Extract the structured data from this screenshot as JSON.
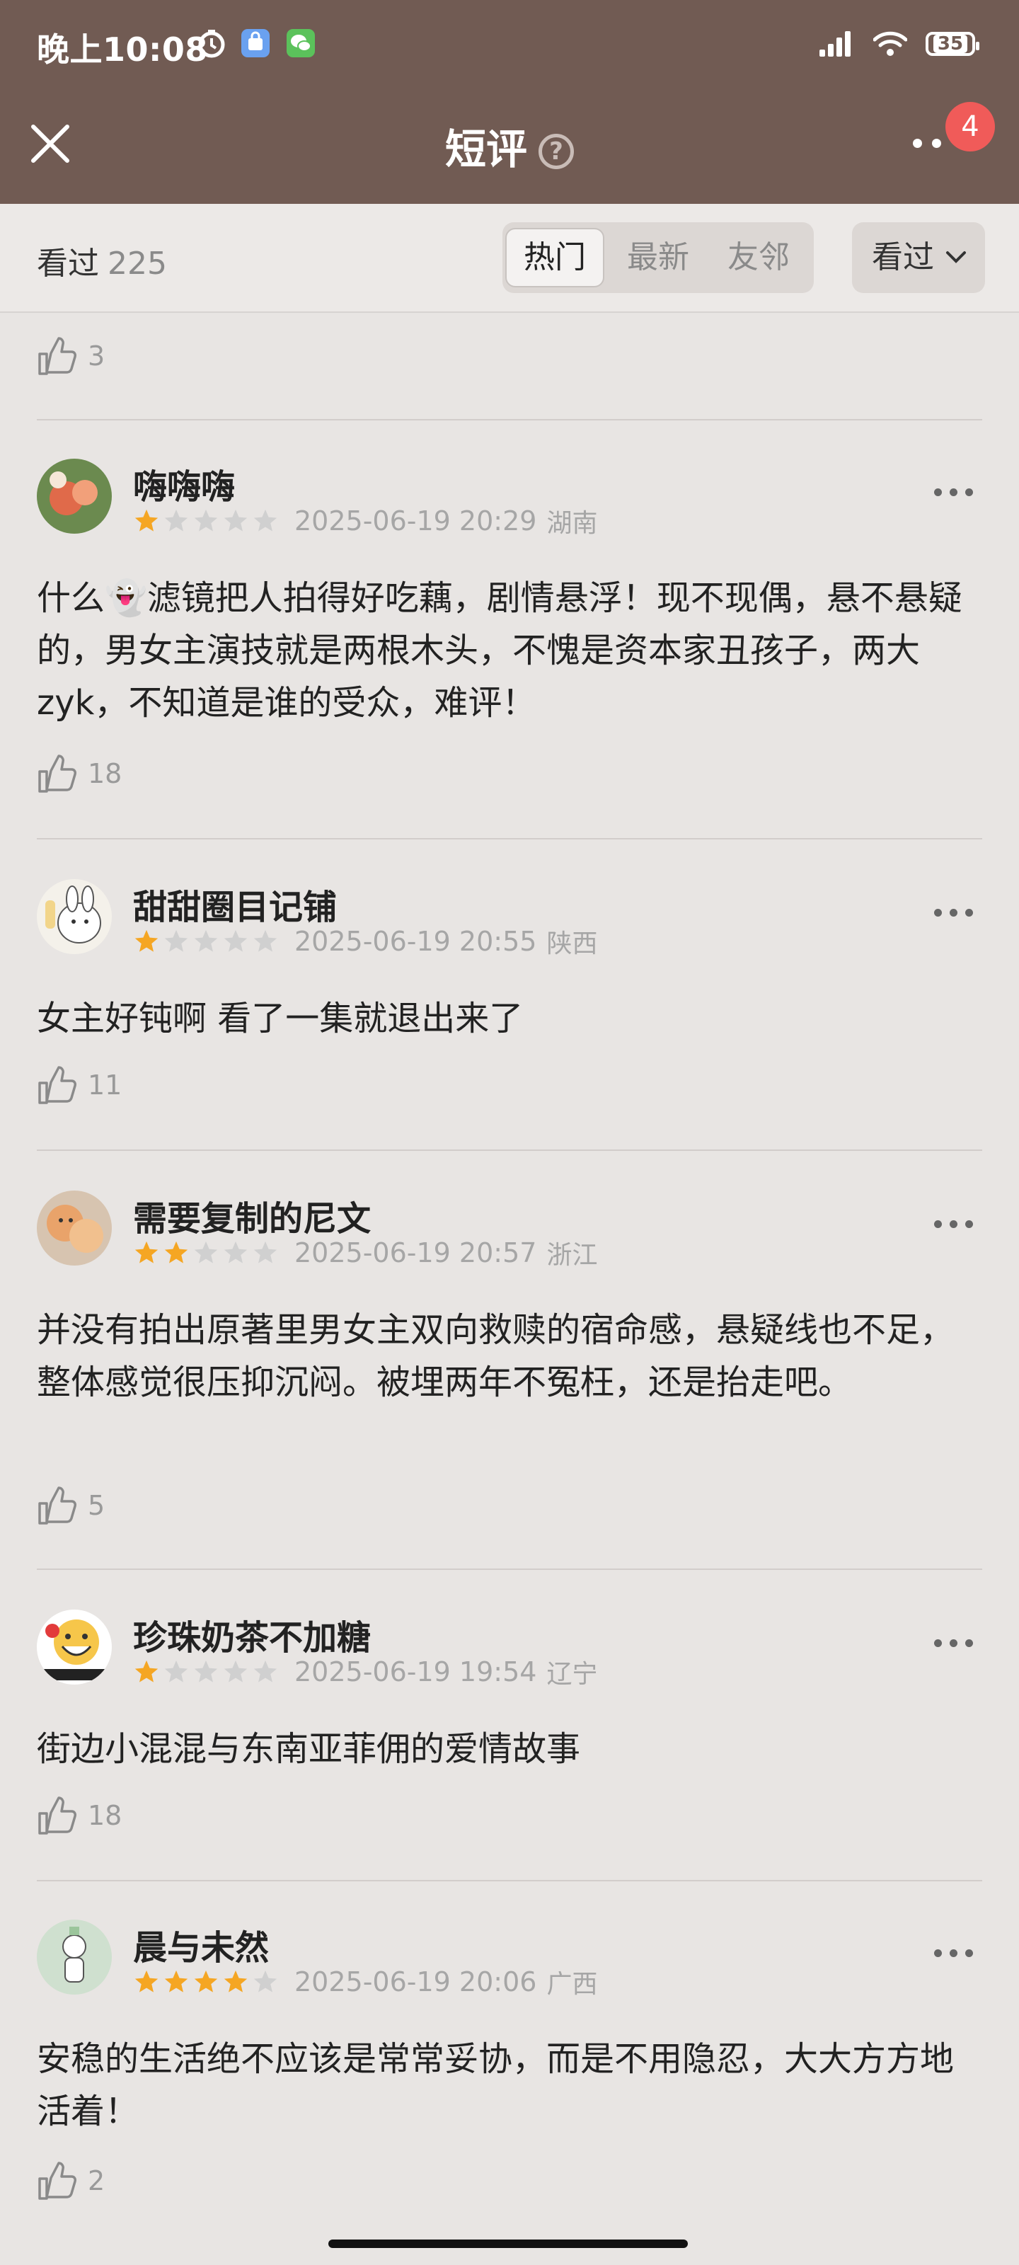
{
  "status_bar": {
    "time": "晚上10:08",
    "battery": "35"
  },
  "header": {
    "title": "短评",
    "help_icon": "?",
    "notification_count": "4"
  },
  "filter": {
    "seen_label": "看过",
    "seen_count": "225",
    "tabs": [
      {
        "label": "热门"
      },
      {
        "label": "最新"
      },
      {
        "label": "友邻"
      }
    ],
    "dropdown_label": "看过"
  },
  "top_like": {
    "count": "3"
  },
  "reviews": [
    {
      "username": "嗨嗨嗨",
      "rating": 1,
      "date": "2025-06-19 20:29",
      "region": "湖南",
      "text": "什么👻滤镜把人拍得好吃藕，剧情悬浮！现不现偶，悬不悬疑的，男女主演技就是两根木头，不愧是资本家丑孩子，两大zyk，不知道是谁的受众，难评！",
      "likes": "18"
    },
    {
      "username": "甜甜圈目记铺",
      "rating": 1,
      "date": "2025-06-19 20:55",
      "region": "陕西",
      "text": "女主好钝啊 看了一集就退出来了",
      "likes": "11"
    },
    {
      "username": "需要复制的尼文",
      "rating": 2,
      "date": "2025-06-19 20:57",
      "region": "浙江",
      "text": "并没有拍出原著里男女主双向救赎的宿命感，悬疑线也不足，整体感觉很压抑沉闷。被埋两年不冤枉，还是抬走吧。",
      "likes": "5"
    },
    {
      "username": "珍珠奶茶不加糖",
      "rating": 1,
      "date": "2025-06-19 19:54",
      "region": "辽宁",
      "text": "街边小混混与东南亚菲佣的爱情故事",
      "likes": "18"
    },
    {
      "username": "晨与未然",
      "rating": 4,
      "date": "2025-06-19 20:06",
      "region": "广西",
      "text": "安稳的生活绝不应该是常常妥协，而是不用隐忍，大大方方地活着！",
      "likes": "2"
    }
  ],
  "colors": {
    "header_bg": "#715b53",
    "star_filled": "#f5a623",
    "star_empty": "#d0d0d0",
    "badge": "#f05b59"
  }
}
